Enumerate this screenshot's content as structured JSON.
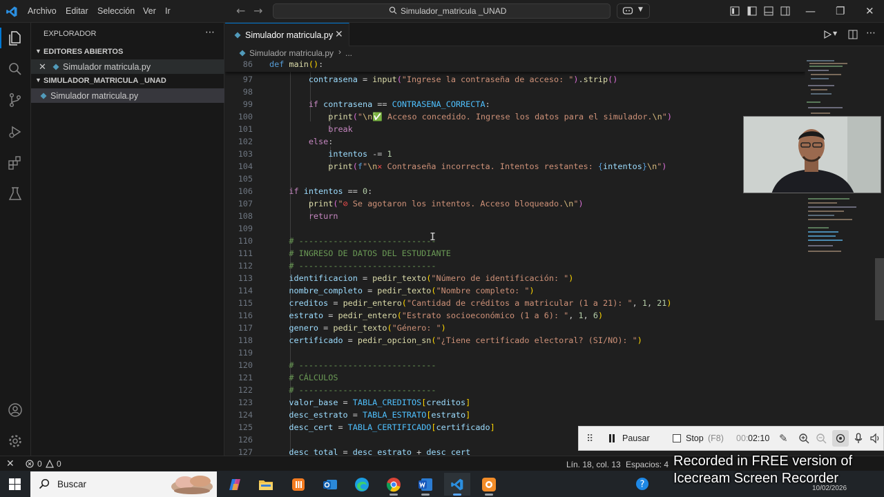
{
  "menu": [
    "Archivo",
    "Editar",
    "Selección",
    "Ver",
    "Ir"
  ],
  "search_text": "Simulador_matricula _UNAD",
  "sidebar": {
    "title": "EXPLORADOR",
    "open_editors_label": "EDITORES ABIERTOS",
    "open_editor_file": "Simulador matricula.py",
    "folder_label": "SIMULADOR_MATRICULA _UNAD",
    "folder_file": "Simulador matricula.py"
  },
  "tab": {
    "label": "Simulador matricula.py"
  },
  "breadcrumb": {
    "file": "Simulador matricula.py",
    "more": "..."
  },
  "code": {
    "sticky_number": "86",
    "line_numbers": [
      "97",
      "98",
      "99",
      "100",
      "101",
      "102",
      "103",
      "104",
      "105",
      "106",
      "107",
      "108",
      "109",
      "110",
      "111",
      "112",
      "113",
      "114",
      "115",
      "116",
      "117",
      "118",
      "119",
      "120",
      "121",
      "122",
      "123",
      "124",
      "125",
      "126",
      "127"
    ]
  },
  "statusbar": {
    "errors": "0",
    "warnings": "0",
    "position": "Lín. 18, col. 13",
    "spaces": "Espacios: 4"
  },
  "recorder": {
    "pause_label": "Pausar",
    "stop_label": "Stop",
    "stop_hotkey": "(F8)",
    "time_prefix": "00:",
    "time": "02:10"
  },
  "watermark": "Recorded in FREE version of\nIcecream Screen Recorder",
  "taskbar": {
    "search_label": "Buscar",
    "date": "10/02/2026"
  },
  "colors": {
    "accent": "#0078d4",
    "editor_bg": "#1f1f1f",
    "sidebar_bg": "#181818"
  }
}
